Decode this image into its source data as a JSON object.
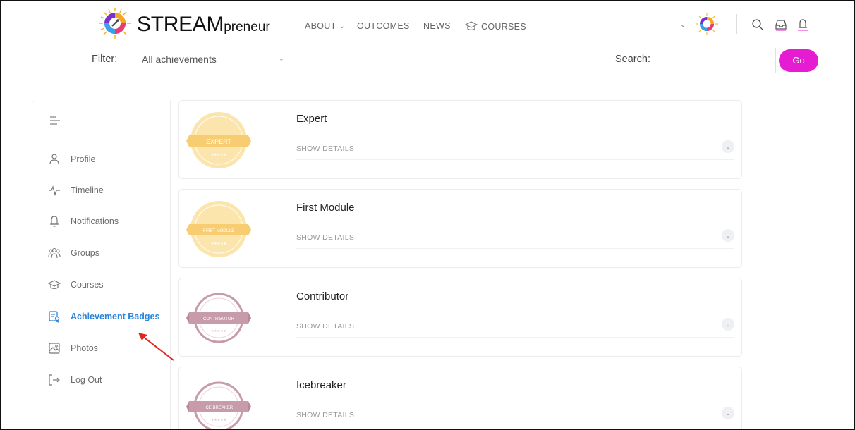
{
  "header": {
    "logo_text": "STREAM",
    "logo_suffix": "preneur",
    "nav": [
      {
        "label": "ABOUT",
        "has_dropdown": true
      },
      {
        "label": "OUTCOMES",
        "has_dropdown": false
      },
      {
        "label": "NEWS",
        "has_dropdown": false
      },
      {
        "label": "COURSES",
        "icon": "graduation-cap-icon"
      }
    ],
    "right_icons": [
      "profile-avatar",
      "search-icon",
      "inbox-icon",
      "bell-icon"
    ]
  },
  "filter": {
    "label": "Filter:",
    "selected": "All achievements"
  },
  "search": {
    "label": "Search:",
    "value": "",
    "button": "Go"
  },
  "sidebar": {
    "items": [
      {
        "label": "Profile",
        "icon": "user-icon"
      },
      {
        "label": "Timeline",
        "icon": "activity-icon"
      },
      {
        "label": "Notifications",
        "icon": "bell-icon"
      },
      {
        "label": "Groups",
        "icon": "groups-icon"
      },
      {
        "label": "Courses",
        "icon": "graduation-cap-icon"
      },
      {
        "label": "Achievement Badges",
        "icon": "badge-icon",
        "active": true
      },
      {
        "label": "Photos",
        "icon": "image-icon"
      },
      {
        "label": "Log Out",
        "icon": "logout-icon"
      }
    ]
  },
  "badges": [
    {
      "title": "Expert",
      "ribbon": "EXPERT",
      "details": "SHOW DETAILS",
      "color": "#f8d27a"
    },
    {
      "title": "First Module",
      "ribbon": "FIRST MODULE",
      "details": "SHOW DETAILS",
      "color": "#f8d27a"
    },
    {
      "title": "Contributor",
      "ribbon": "CONTRIBUTOR",
      "details": "SHOW DETAILS",
      "color": "#c79ba9"
    },
    {
      "title": "Icebreaker",
      "ribbon": "ICE BREAKER",
      "details": "SHOW DETAILS",
      "color": "#c79ba9"
    }
  ],
  "colors": {
    "accent": "#e51cd2",
    "active_link": "#2b84d8"
  }
}
